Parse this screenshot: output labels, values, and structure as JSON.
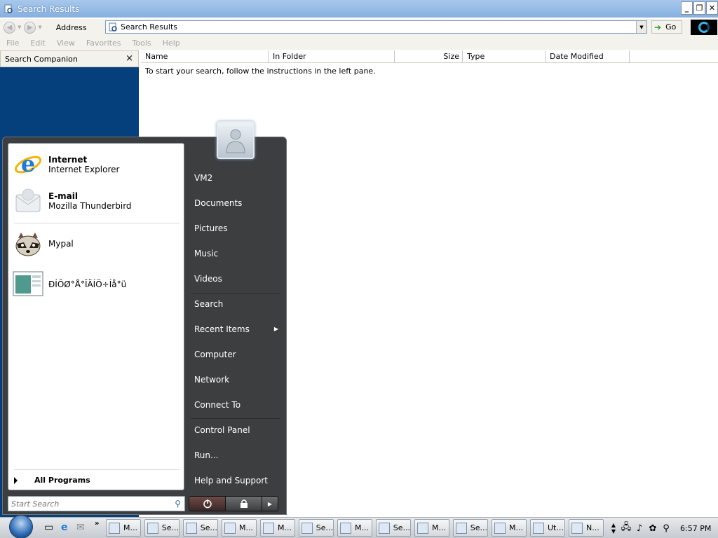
{
  "window": {
    "title": "Search Results",
    "buttons": {
      "minimize": "_",
      "restore": "❐",
      "close": "✕"
    }
  },
  "address": {
    "label": "Address",
    "value": "Search Results",
    "go": "Go"
  },
  "menu": [
    "File",
    "Edit",
    "View",
    "Favorites",
    "Tools",
    "Help"
  ],
  "companion": {
    "title": "Search Companion",
    "close": "×"
  },
  "results": {
    "columns": [
      "Name",
      "In Folder",
      "Size",
      "Type",
      "Date Modified"
    ],
    "hint": "To start your search, follow the instructions in the left pane."
  },
  "start_menu": {
    "pinned": [
      {
        "title": "Internet",
        "subtitle": "Internet Explorer",
        "icon": "ie-icon"
      },
      {
        "title": "E-mail",
        "subtitle": "Mozilla Thunderbird",
        "icon": "mail-icon"
      }
    ],
    "recent": [
      {
        "label": "Mypal",
        "icon": "mypal-raccoon-icon"
      },
      {
        "label": "ÐÍÔØ°Å°ÎÄÍÖ÷Íå°ü",
        "icon": "app-window-icon"
      }
    ],
    "all_programs": "All Programs",
    "search_placeholder": "Start Search",
    "right_items": [
      "VM2",
      "Documents",
      "Pictures",
      "Music",
      "Videos",
      "Search",
      "Recent Items",
      "Computer",
      "Network",
      "Connect To",
      "Control Panel",
      "Run...",
      "Help and Support"
    ]
  },
  "taskbar": {
    "buttons": [
      "M...",
      "Se...",
      "Se...",
      "M...",
      "M...",
      "Se...",
      "M...",
      "Se...",
      "M...",
      "Se...",
      "M...",
      "Ut...",
      "N..."
    ],
    "clock": "6:57 PM"
  }
}
